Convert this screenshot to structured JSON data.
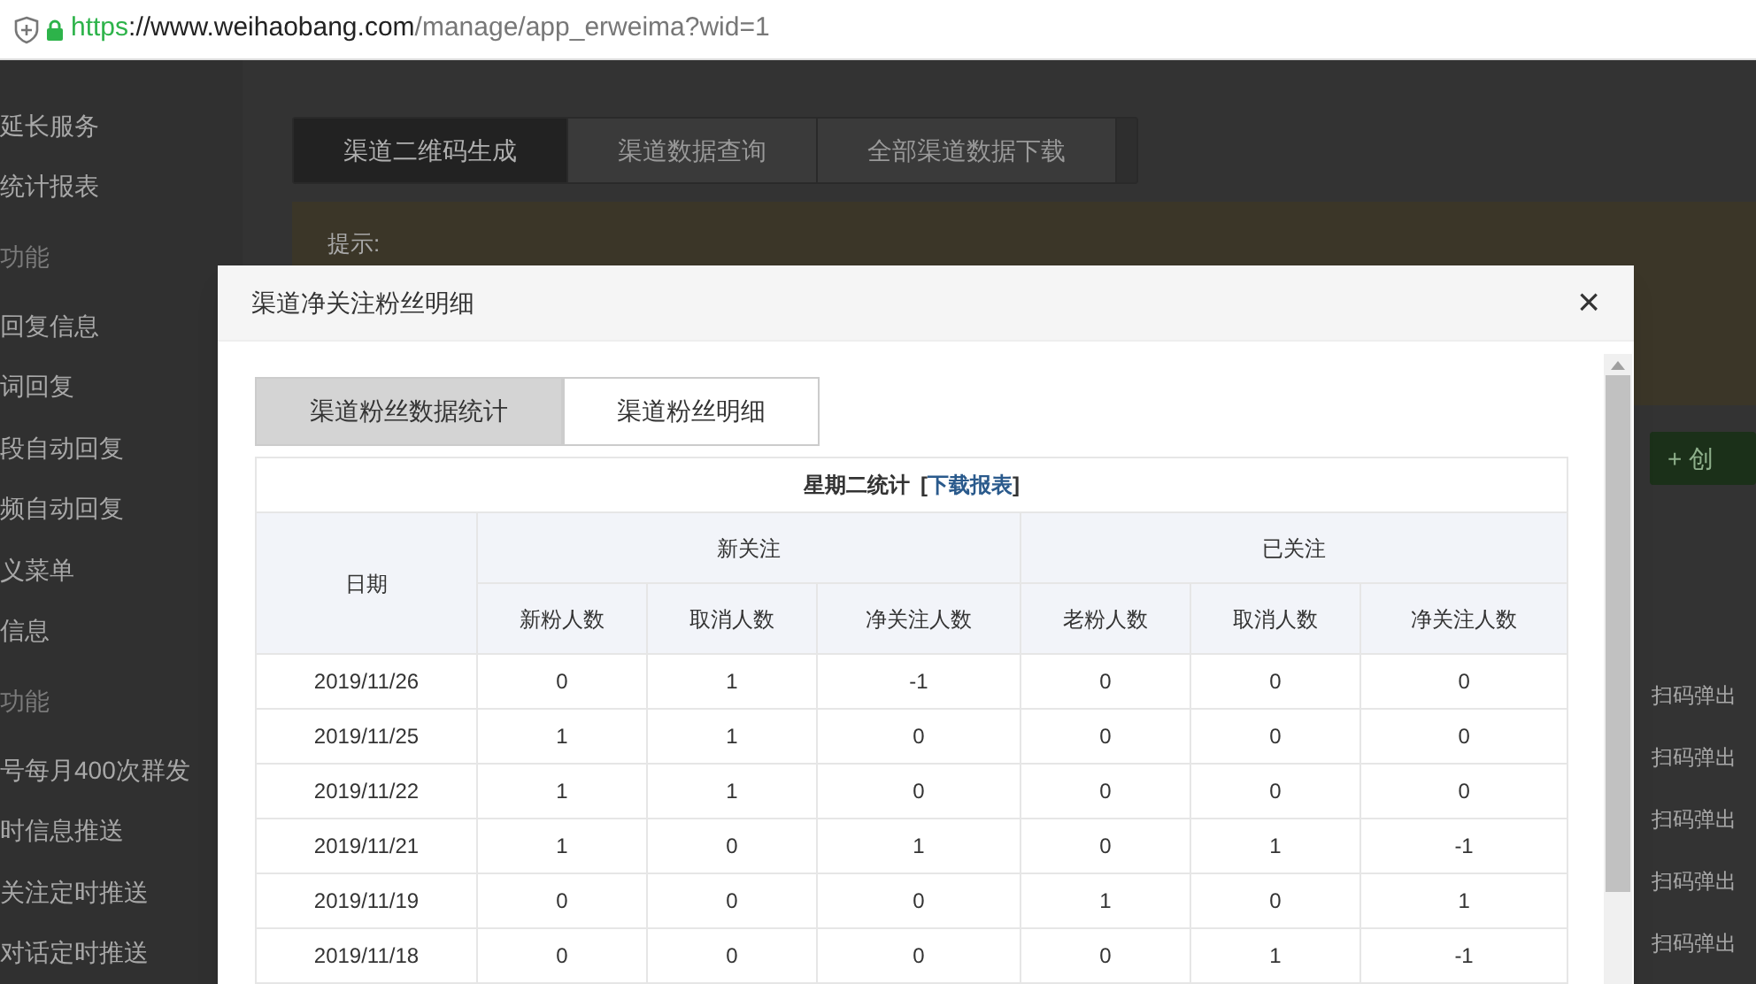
{
  "address_bar": {
    "scheme": "https",
    "host": "://www.weihaobang.com",
    "path": "/manage/app_erweima?wid=1"
  },
  "sidebar": {
    "items": [
      {
        "kind": "item",
        "label": "延长服务"
      },
      {
        "kind": "item",
        "label": "统计报表"
      },
      {
        "kind": "header",
        "label": "功能"
      },
      {
        "kind": "item",
        "label": "回复信息"
      },
      {
        "kind": "item",
        "label": "词回复"
      },
      {
        "kind": "item",
        "label": "段自动回复"
      },
      {
        "kind": "item",
        "label": "频自动回复"
      },
      {
        "kind": "item",
        "label": "义菜单"
      },
      {
        "kind": "item",
        "label": "信息"
      },
      {
        "kind": "header",
        "label": "功能"
      },
      {
        "kind": "item",
        "label": "号每月400次群发"
      },
      {
        "kind": "item",
        "label": "时信息推送"
      },
      {
        "kind": "item",
        "label": "关注定时推送"
      },
      {
        "kind": "item",
        "label": "对话定时推送"
      }
    ]
  },
  "page_tabs": [
    {
      "label": "渠道二维码生成",
      "selected": true
    },
    {
      "label": "渠道数据查询",
      "selected": false
    },
    {
      "label": "全部渠道数据下载",
      "selected": false
    }
  ],
  "hint": {
    "label": "提示:"
  },
  "create_button": {
    "icon": "+",
    "label": "创"
  },
  "list_items": [
    "扫码弹出",
    "扫码弹出",
    "扫码弹出",
    "扫码弹出",
    "扫码弹出"
  ],
  "modal": {
    "title": "渠道净关注粉丝明细",
    "close": "×",
    "tabs": [
      {
        "label": "渠道粉丝数据统计",
        "selected": true
      },
      {
        "label": "渠道粉丝明细",
        "selected": false
      }
    ],
    "table": {
      "title": "星期二统计",
      "bracket_open": "[",
      "link": "下载报表",
      "bracket_close": "]",
      "date_header": "日期",
      "groups": [
        {
          "label": "新关注",
          "columns": [
            "新粉人数",
            "取消人数",
            "净关注人数"
          ]
        },
        {
          "label": "已关注",
          "columns": [
            "老粉人数",
            "取消人数",
            "净关注人数"
          ]
        }
      ],
      "rows": [
        [
          "2019/11/26",
          "0",
          "1",
          "-1",
          "0",
          "0",
          "0"
        ],
        [
          "2019/11/25",
          "1",
          "1",
          "0",
          "0",
          "0",
          "0"
        ],
        [
          "2019/11/22",
          "1",
          "1",
          "0",
          "0",
          "0",
          "0"
        ],
        [
          "2019/11/21",
          "1",
          "0",
          "1",
          "0",
          "1",
          "-1"
        ],
        [
          "2019/11/19",
          "0",
          "0",
          "0",
          "1",
          "0",
          "1"
        ],
        [
          "2019/11/18",
          "0",
          "0",
          "0",
          "0",
          "1",
          "-1"
        ]
      ]
    }
  }
}
